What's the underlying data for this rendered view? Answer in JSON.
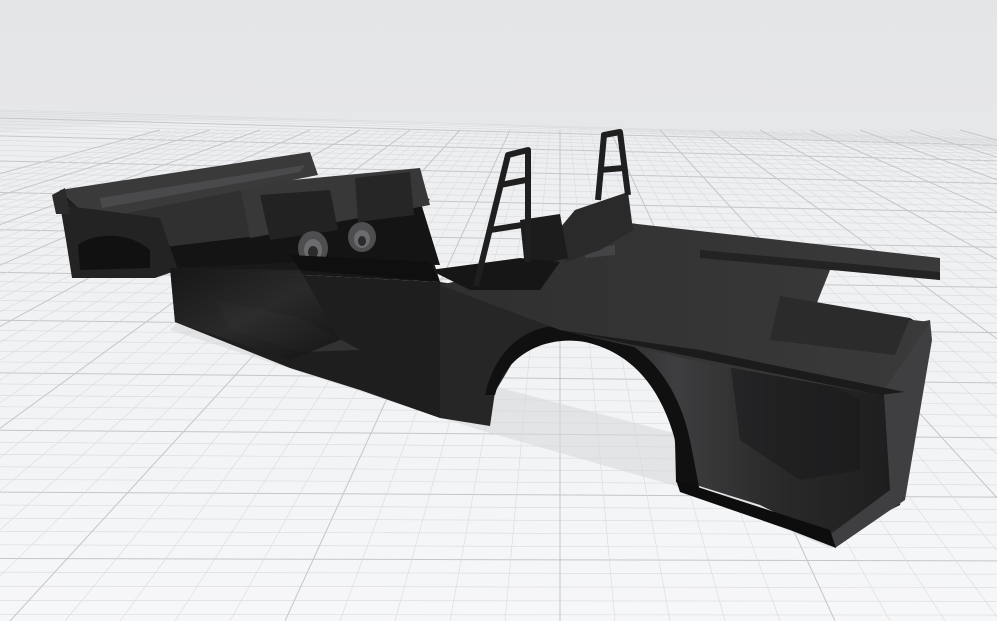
{
  "viewer": {
    "background_color": "#e9eaec",
    "ground_color": "#f2f3f4",
    "grid_minor_color": "#d9dadd",
    "grid_major_color": "#c4c6ca"
  },
  "model": {
    "base_color": "#2d2d2e",
    "shadow_color": "#141415",
    "highlight_color": "#575758"
  }
}
